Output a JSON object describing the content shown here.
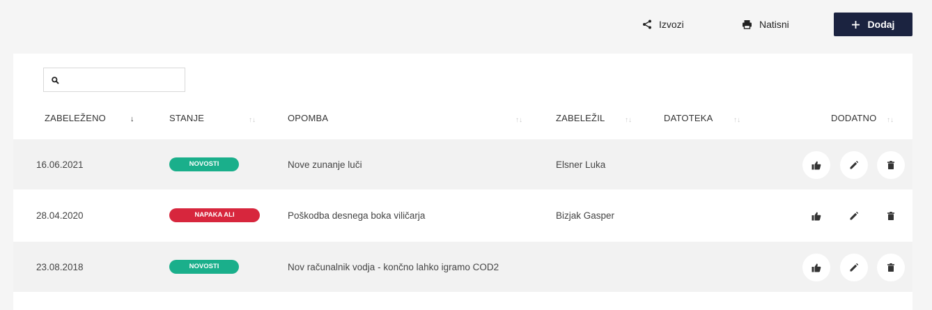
{
  "toolbar": {
    "export_label": "Izvozi",
    "print_label": "Natisni",
    "add_label": "Dodaj",
    "add_color": "#1b2340"
  },
  "search": {
    "placeholder": "",
    "value": ""
  },
  "table": {
    "columns": [
      {
        "label": "ZABELEŽENO",
        "sorted": "desc"
      },
      {
        "label": "STANJE",
        "sorted": "none"
      },
      {
        "label": "OPOMBA",
        "sorted": "none"
      },
      {
        "label": "ZABELEŽIL",
        "sorted": "none"
      },
      {
        "label": "DATOTEKA",
        "sorted": "none"
      },
      {
        "label": "DODATNO",
        "sorted": "none"
      }
    ],
    "rows": [
      {
        "date": "16.06.2021",
        "status": "NOVOSTI",
        "status_color": "#1aaf8b",
        "note": "Nove zunanje luči",
        "author": "Elsner Luka",
        "file": ""
      },
      {
        "date": "28.04.2020",
        "status": "NAPAKA ALI POŠKODBA",
        "status_color": "#d7263d",
        "note": "Poškodba desnega boka viličarja",
        "author": "Bizjak Gasper",
        "file": ""
      },
      {
        "date": "23.08.2018",
        "status": "NOVOSTI",
        "status_color": "#1aaf8b",
        "note": "Nov računalnik vodja - končno lahko igramo COD2",
        "author": "",
        "file": ""
      }
    ],
    "row_actions": [
      "thumbs-up-icon",
      "pencil-icon",
      "trash-icon"
    ]
  }
}
